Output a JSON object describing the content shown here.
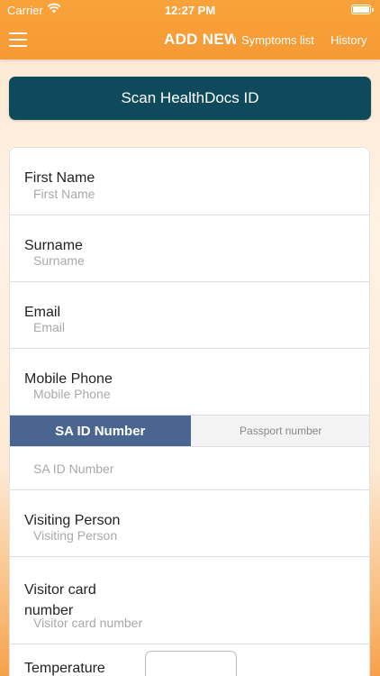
{
  "status": {
    "carrier": "Carrier",
    "time": "12:27 PM"
  },
  "navbar": {
    "title": "ADD NEW",
    "symptoms_link": "Symptoms list",
    "history_link": "History",
    "menu_icon": "hamburger-menu-icon"
  },
  "scan_button": {
    "label": "Scan HealthDocs ID"
  },
  "form": {
    "first_name": {
      "label": "First Name",
      "placeholder": "First Name"
    },
    "surname": {
      "label": "Surname",
      "placeholder": "Surname"
    },
    "email": {
      "label": "Email",
      "placeholder": "Email"
    },
    "mobile_phone": {
      "label": "Mobile Phone",
      "placeholder": "Mobile Phone"
    },
    "id_type": {
      "options": [
        "SA ID Number",
        "Passport number"
      ],
      "selected": "SA ID Number"
    },
    "id_number": {
      "placeholder": "SA ID Number"
    },
    "visiting_person": {
      "label": "Visiting Person",
      "placeholder": "Visiting Person"
    },
    "visitor_card": {
      "label_line1": "Visitor card",
      "label_line2": "number",
      "placeholder": "Visitor card number"
    },
    "temperature": {
      "label": "Temperature"
    }
  },
  "colors": {
    "nav_orange": "#f59a35",
    "scan_button": "#0e4a5c",
    "segment_active": "#4a6690"
  }
}
